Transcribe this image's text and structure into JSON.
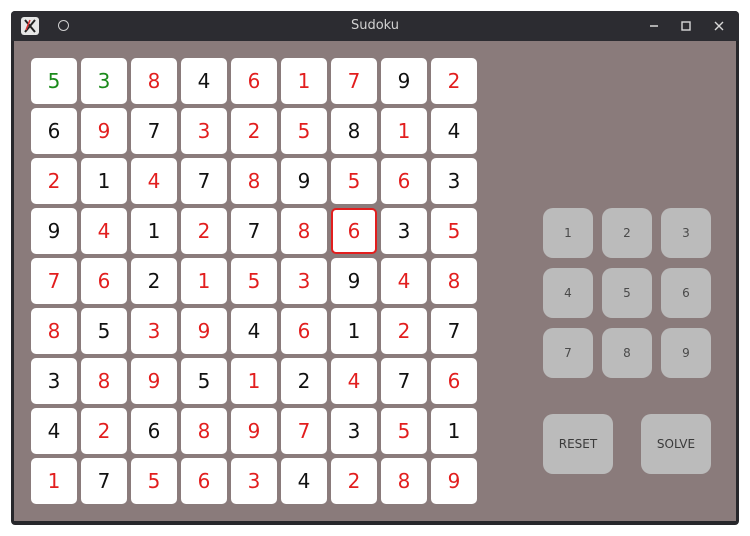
{
  "window": {
    "title": "Sudoku",
    "app_icon": "app-icon",
    "pin_icon": "circle-icon",
    "controls": [
      "minimize-icon",
      "maximize-icon",
      "close-icon"
    ]
  },
  "colors": {
    "given": "#1a8a1a",
    "filled": "#e21e1e",
    "default": "#111111",
    "selected_border": "#e21e1e",
    "board_bg": "#8a7b7b",
    "button_bg": "#bbbbbb"
  },
  "board": {
    "rows": [
      [
        "5",
        "3",
        "8",
        "4",
        "6",
        "1",
        "7",
        "9",
        "2"
      ],
      [
        "6",
        "9",
        "7",
        "3",
        "2",
        "5",
        "8",
        "1",
        "4"
      ],
      [
        "2",
        "1",
        "4",
        "7",
        "8",
        "9",
        "5",
        "6",
        "3"
      ],
      [
        "9",
        "4",
        "1",
        "2",
        "7",
        "8",
        "6",
        "3",
        "5"
      ],
      [
        "7",
        "6",
        "2",
        "1",
        "5",
        "3",
        "9",
        "4",
        "8"
      ],
      [
        "8",
        "5",
        "3",
        "9",
        "4",
        "6",
        "1",
        "2",
        "7"
      ],
      [
        "3",
        "8",
        "9",
        "5",
        "1",
        "2",
        "4",
        "7",
        "6"
      ],
      [
        "4",
        "2",
        "6",
        "8",
        "9",
        "7",
        "3",
        "5",
        "1"
      ],
      [
        "1",
        "7",
        "5",
        "6",
        "3",
        "4",
        "2",
        "8",
        "9"
      ]
    ],
    "cell_colors": [
      [
        "given",
        "given",
        "filled",
        "default",
        "filled",
        "filled",
        "filled",
        "default",
        "filled"
      ],
      [
        "default",
        "filled",
        "default",
        "filled",
        "filled",
        "filled",
        "default",
        "filled",
        "default"
      ],
      [
        "filled",
        "default",
        "filled",
        "default",
        "filled",
        "default",
        "filled",
        "filled",
        "default"
      ],
      [
        "default",
        "filled",
        "default",
        "filled",
        "default",
        "filled",
        "filled",
        "default",
        "filled"
      ],
      [
        "filled",
        "filled",
        "default",
        "filled",
        "filled",
        "filled",
        "default",
        "filled",
        "filled"
      ],
      [
        "filled",
        "default",
        "filled",
        "filled",
        "default",
        "filled",
        "default",
        "filled",
        "default"
      ],
      [
        "default",
        "filled",
        "filled",
        "default",
        "filled",
        "default",
        "filled",
        "default",
        "filled"
      ],
      [
        "default",
        "filled",
        "default",
        "filled",
        "filled",
        "filled",
        "default",
        "filled",
        "default"
      ],
      [
        "filled",
        "default",
        "filled",
        "filled",
        "filled",
        "default",
        "filled",
        "filled",
        "filled"
      ]
    ],
    "selected": {
      "row": 4,
      "col": 7
    }
  },
  "keypad": [
    "1",
    "2",
    "3",
    "4",
    "5",
    "6",
    "7",
    "8",
    "9"
  ],
  "actions": {
    "reset": "RESET",
    "solve": "SOLVE"
  }
}
